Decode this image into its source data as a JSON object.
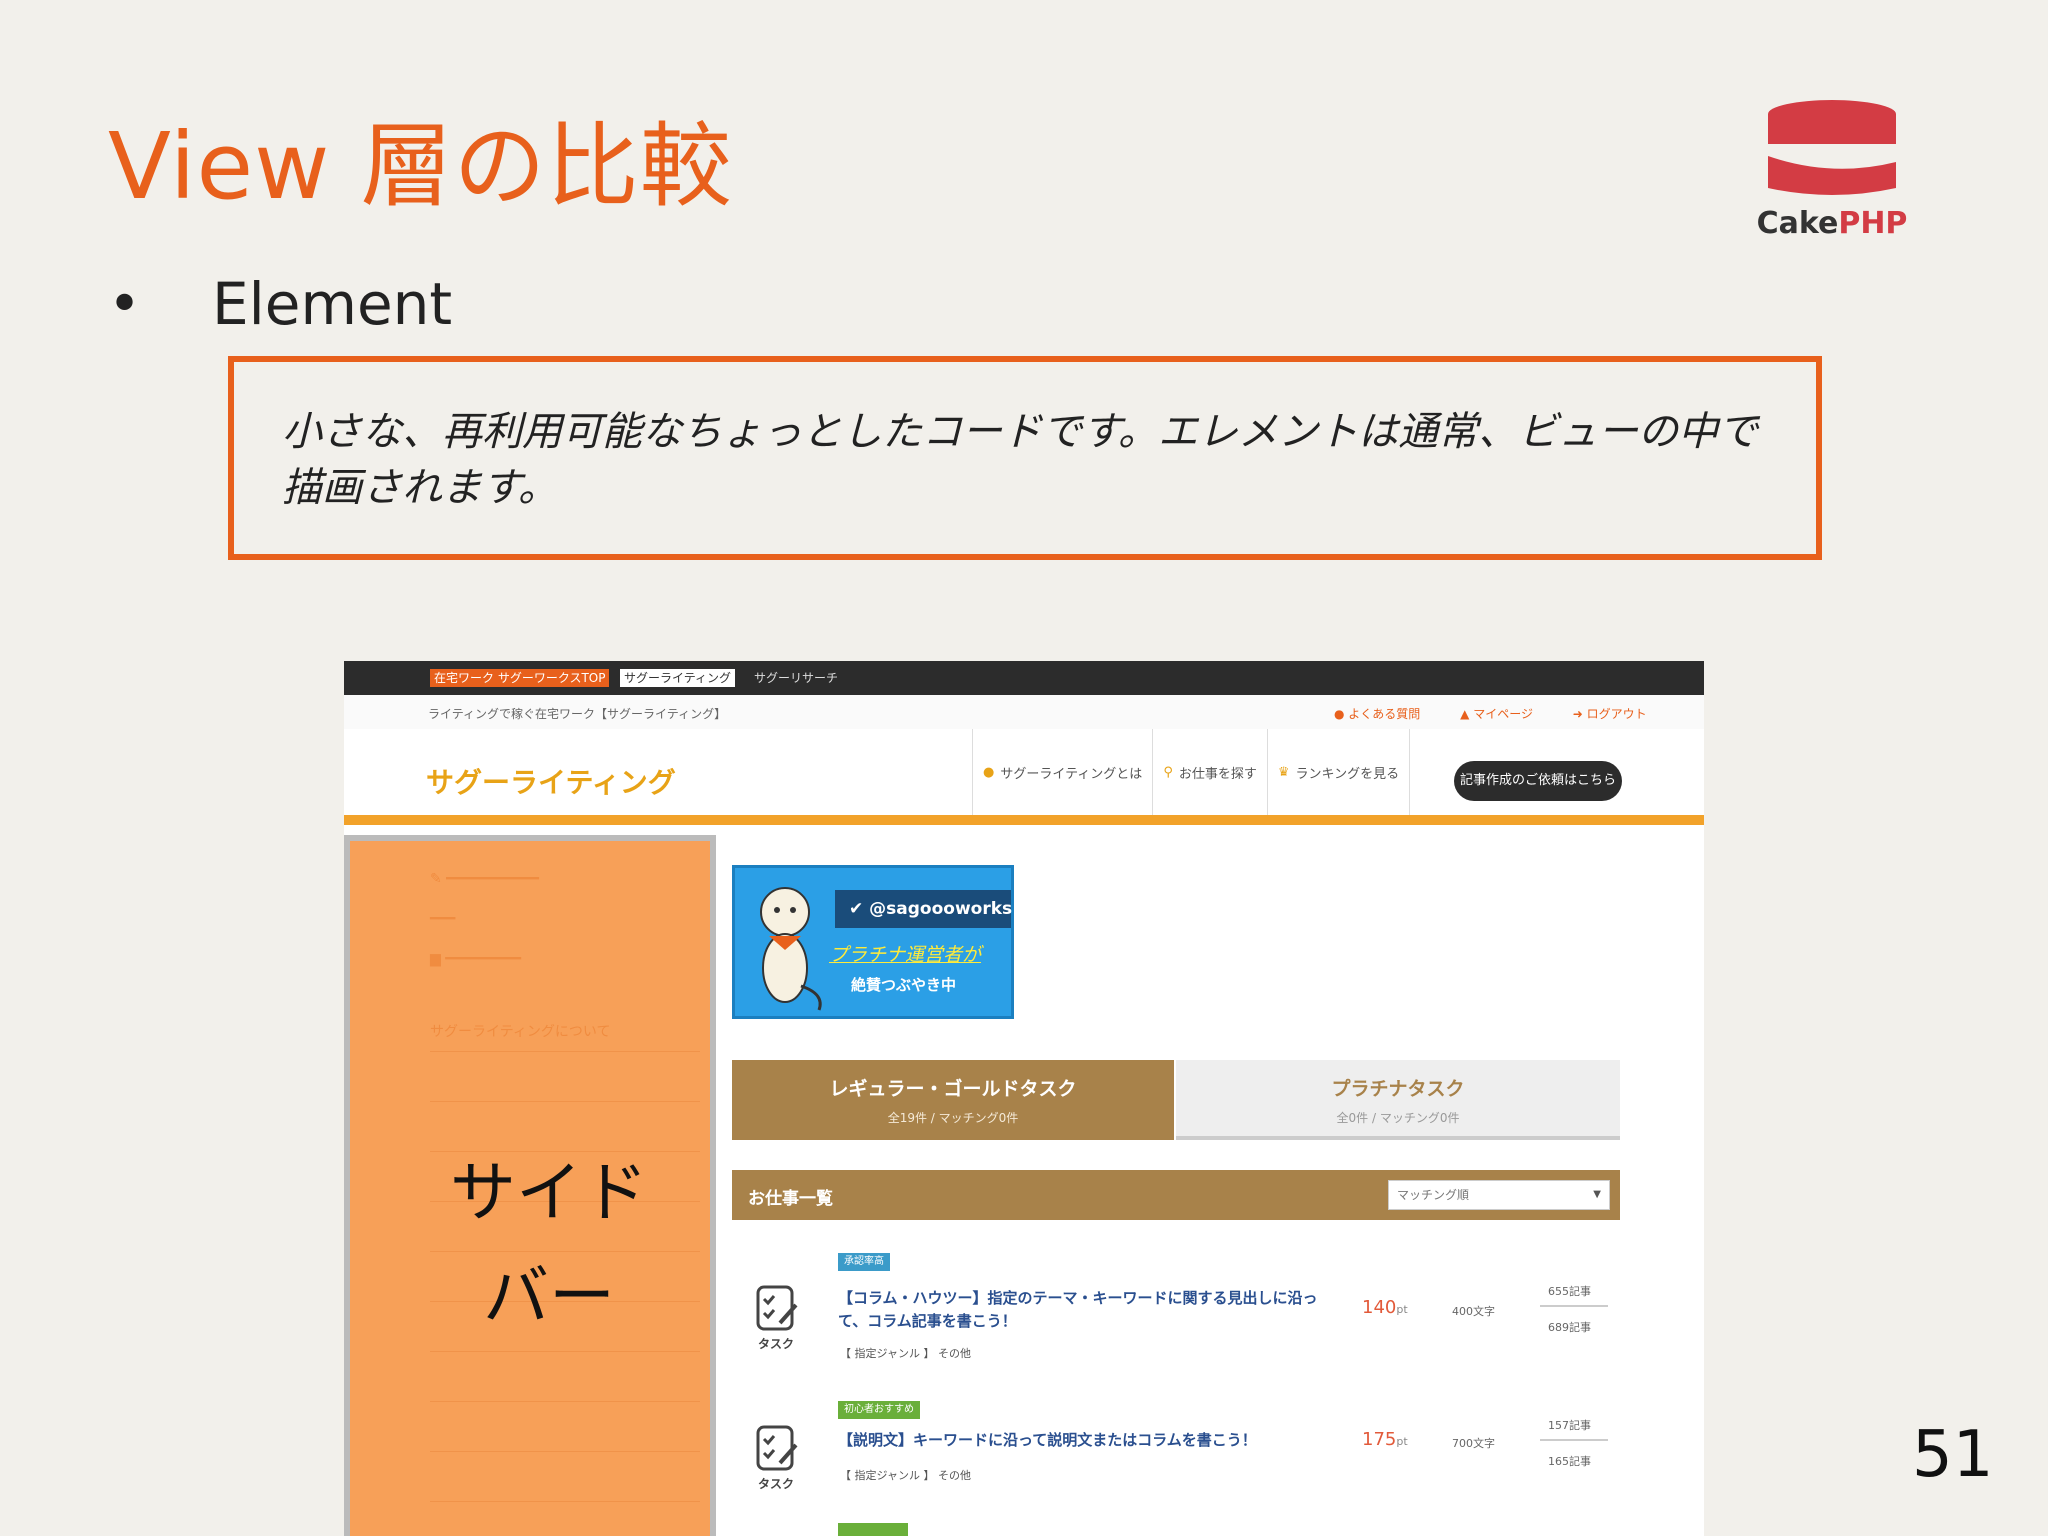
{
  "slide": {
    "title": "View 層の比較",
    "bullet_marker": "•",
    "bullet": "Element",
    "quote": "小さな、再利用可能なちょっとしたコードです。エレメントは通常、ビューの中で描画されます。",
    "page_number": "51",
    "logo": {
      "text_cake": "Cake",
      "text_php": "PHP",
      "icon": "cakephp-logo-icon",
      "color": "#d33c44"
    },
    "accent_color": "#e8601c"
  },
  "screenshot": {
    "topbar": {
      "tag1": "在宅ワーク サグーワークスTOP",
      "tag2": "サグーライティング",
      "tag3": "サグーリサーチ"
    },
    "subbar": {
      "tagline": "ライティングで稼ぐ在宅ワーク【サグーライティング】",
      "links": [
        "よくある質問",
        "マイページ",
        "ログアウト"
      ]
    },
    "header": {
      "brand": "サグーライティング",
      "nav": [
        "サグーライティングとは",
        "お仕事を探す",
        "ランキングを見る"
      ],
      "cta": "記事作成のご依頼はこちら"
    },
    "sidebar": {
      "label": "サイドバー",
      "items": [
        "サグーライティングについて"
      ]
    },
    "twitter": {
      "handle": "@sagoooworks",
      "line1": "プラチナ運営者が",
      "line2": "絶賛つぶやき中"
    },
    "tabs": [
      {
        "title": "レギュラー・ゴールドタスク",
        "sub": "全19件 / マッチング0件"
      },
      {
        "title": "プラチナタスク",
        "sub": "全0件 / マッチング0件"
      }
    ],
    "list": {
      "title": "お仕事一覧",
      "sort": "マッチング順",
      "tasks": [
        {
          "icon_label": "タスク",
          "badge": "承認率高",
          "title": "【コラム・ハウツー】指定のテーマ・キーワードに関する見出しに沿って、コラム記事を書こう！",
          "genre": "【 指定ジャンル 】 その他",
          "points": "140",
          "pt_unit": "pt",
          "chars": "400文字",
          "count1": "655記事",
          "count2": "689記事"
        },
        {
          "icon_label": "タスク",
          "badge": "初心者おすすめ",
          "title": "【説明文】キーワードに沿って説明文またはコラムを書こう！",
          "genre": "【 指定ジャンル 】 その他",
          "points": "175",
          "pt_unit": "pt",
          "chars": "700文字",
          "count1": "157記事",
          "count2": "165記事"
        }
      ],
      "badge_colors": [
        "#3b9bc9",
        "#6aaf3a"
      ]
    }
  }
}
